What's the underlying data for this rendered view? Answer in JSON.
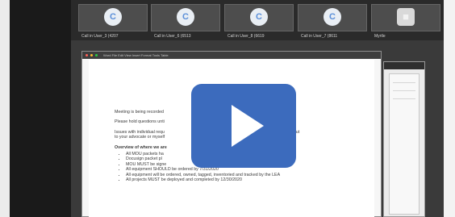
{
  "participants": [
    {
      "label": "Call in User_3 (4207",
      "avatar": "C"
    },
    {
      "label": "Call in User_6 (6513",
      "avatar": "C"
    },
    {
      "label": "Call in User_8 (6619",
      "avatar": "C"
    },
    {
      "label": "Call in User_7 (8611",
      "avatar": "C"
    },
    {
      "label": "Myrtle",
      "avatar": "person-icon"
    }
  ],
  "doc_window": {
    "menu": "Word  File  Edit  View  Insert  Format  Tools  Table"
  },
  "document": {
    "line1": "Meeting is being recorded",
    "line2": "Please hold questions unti",
    "line3a": "Issues with individual requ",
    "line3b": "to your advocate or myself",
    "line3c": "out",
    "heading": "Overview of where we are",
    "bullets": [
      "All MOU packets ha",
      "Docusign packet pl",
      "MOU MUST be signe",
      "All equipment SHOULD be ordered by 7/31/2020",
      "All equipment will be ordered, owned, tagged, inventoried and tracked by the LEA",
      "All projects MUST be deployed and completed by 12/30/2020"
    ]
  },
  "colors": {
    "play_button": "#3c6bbd",
    "avatar_accent": "#5b8fd9"
  }
}
